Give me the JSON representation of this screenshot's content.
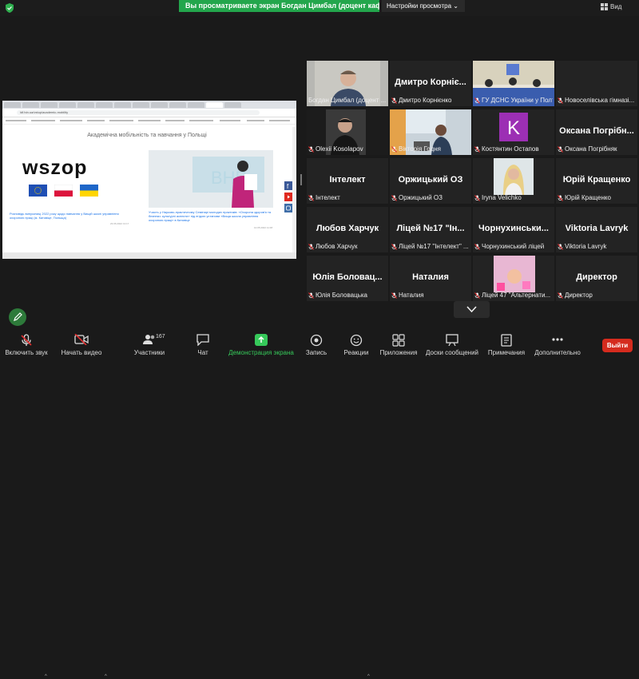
{
  "top_bar": {
    "share_banner": "Вы просматриваете экран Богдан Цимбал (доцент кафедри ...",
    "view_options": "Настройки просмотра",
    "view_button": "Вид"
  },
  "shared_screen": {
    "address": "ldf.lviv.ua/vstup/academic-mobility",
    "page_title": "Академічна мобільність та навчання у Польщі",
    "logo_text": "wszop",
    "news1_title": "Розповідь випускниці 2022 року щодо навчання у Вищій школі управління охороною праці (м. Катовіце, Польща)",
    "news1_date": "23.06.2022 13:17",
    "news2_title": "Участь у Науково-практичному Семінарі молодих практиків: «Охорона здоров'я та безпеки: культурні аспекти» під егідою установи «Вища школа управління охороною праці» в Катовіце",
    "news2_date": "10.05.2022 11:48"
  },
  "participants": [
    {
      "name": "Богдан Цимбал (доцент ...",
      "big": "",
      "muted": false,
      "active": true,
      "video": "man-photo"
    },
    {
      "name": "Дмитро Корнієнко",
      "big": "Дмитро Корніє...",
      "muted": true,
      "active": false,
      "video": ""
    },
    {
      "name": "ГУ ДСНС України у Полт...",
      "big": "",
      "muted": true,
      "active": false,
      "video": "office-photo"
    },
    {
      "name": "Новоселівська гімназі...",
      "big": "",
      "muted": true,
      "active": false,
      "video": ""
    },
    {
      "name": "Olexii Kosolapov",
      "big": "",
      "muted": true,
      "active": false,
      "video": "man-dark-photo"
    },
    {
      "name": "Вікторія Годня",
      "big": "",
      "muted": true,
      "active": false,
      "video": "desk-photo"
    },
    {
      "name": "Костянтин Остапов",
      "big": "",
      "muted": true,
      "active": false,
      "video": "avatar-k"
    },
    {
      "name": "Оксана Погрібняк",
      "big": "Оксана Погрібн...",
      "muted": true,
      "active": false,
      "video": ""
    },
    {
      "name": "Інтелект",
      "big": "Інтелект",
      "muted": true,
      "active": false,
      "video": ""
    },
    {
      "name": "Оржицький ОЗ",
      "big": "Оржицький ОЗ",
      "muted": true,
      "active": false,
      "video": ""
    },
    {
      "name": "Iryna Velichko",
      "big": "",
      "muted": true,
      "active": false,
      "video": "woman-photo"
    },
    {
      "name": "Юрій Кращенко",
      "big": "Юрій Кращенко",
      "muted": true,
      "active": false,
      "video": ""
    },
    {
      "name": "Любов Харчук",
      "big": "Любов Харчук",
      "muted": true,
      "active": false,
      "video": ""
    },
    {
      "name": "Ліцей №17 \"Інтелект\" ...",
      "big": "Ліцей №17 \"Ін...",
      "muted": true,
      "active": false,
      "video": ""
    },
    {
      "name": "Чорнухинський ліцей",
      "big": "Чорнухинськи...",
      "muted": true,
      "active": false,
      "video": ""
    },
    {
      "name": "Viktoria Lavryk",
      "big": "Viktoria Lavryk",
      "muted": true,
      "active": false,
      "video": ""
    },
    {
      "name": "Юлія Боловацька",
      "big": "Юлія Боловац...",
      "muted": true,
      "active": false,
      "video": ""
    },
    {
      "name": "Наталия",
      "big": "Наталия",
      "muted": true,
      "active": false,
      "video": ""
    },
    {
      "name": "Ліцей 47 \"Альтернати...",
      "big": "",
      "muted": true,
      "active": false,
      "video": "pink-photo"
    },
    {
      "name": "Директор",
      "big": "Директор",
      "muted": true,
      "active": false,
      "video": ""
    }
  ],
  "toolbar": {
    "mute": "Включить звук",
    "video": "Начать видео",
    "participants": "Участники",
    "participants_count": "167",
    "chat": "Чат",
    "share": "Демонстрация экрана",
    "record": "Запись",
    "reactions": "Реакции",
    "apps": "Приложения",
    "whiteboards": "Доски сообщений",
    "notes": "Примечания",
    "more": "Дополнительно",
    "leave": "Выйти"
  },
  "colors": {
    "share_green": "#23a64c",
    "leave_red": "#d52b1e",
    "speaker_outline": "#c8e65a"
  }
}
